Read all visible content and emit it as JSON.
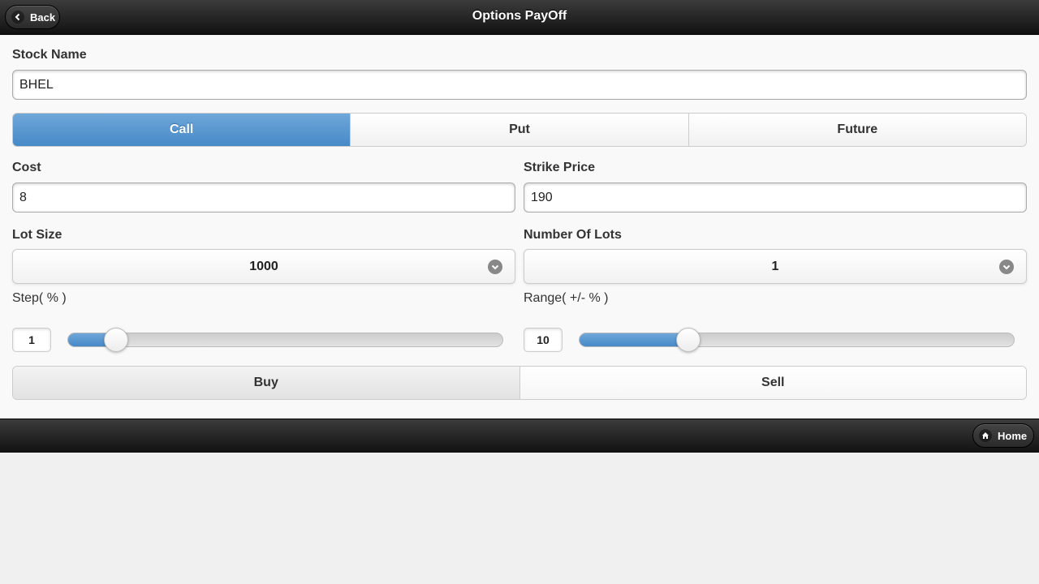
{
  "header": {
    "title": "Options PayOff",
    "back_label": "Back"
  },
  "stock": {
    "label": "Stock Name",
    "value": "BHEL"
  },
  "option_type": {
    "options": [
      "Call",
      "Put",
      "Future"
    ],
    "selected": "Call"
  },
  "cost": {
    "label": "Cost",
    "value": "8"
  },
  "strike": {
    "label": "Strike Price",
    "value": "190"
  },
  "lot_size": {
    "label": "Lot Size",
    "value": "1000"
  },
  "num_lots": {
    "label": "Number Of Lots",
    "value": "1"
  },
  "step": {
    "label": "Step( % )",
    "value": "1",
    "fraction": 0.11
  },
  "range": {
    "label": "Range( +/- % )",
    "value": "10",
    "fraction": 0.25
  },
  "trade": {
    "buy_label": "Buy",
    "sell_label": "Sell"
  },
  "footer": {
    "home_label": "Home"
  },
  "colors": {
    "accent": "#4a8cca",
    "bar": "#1f1f1f"
  }
}
